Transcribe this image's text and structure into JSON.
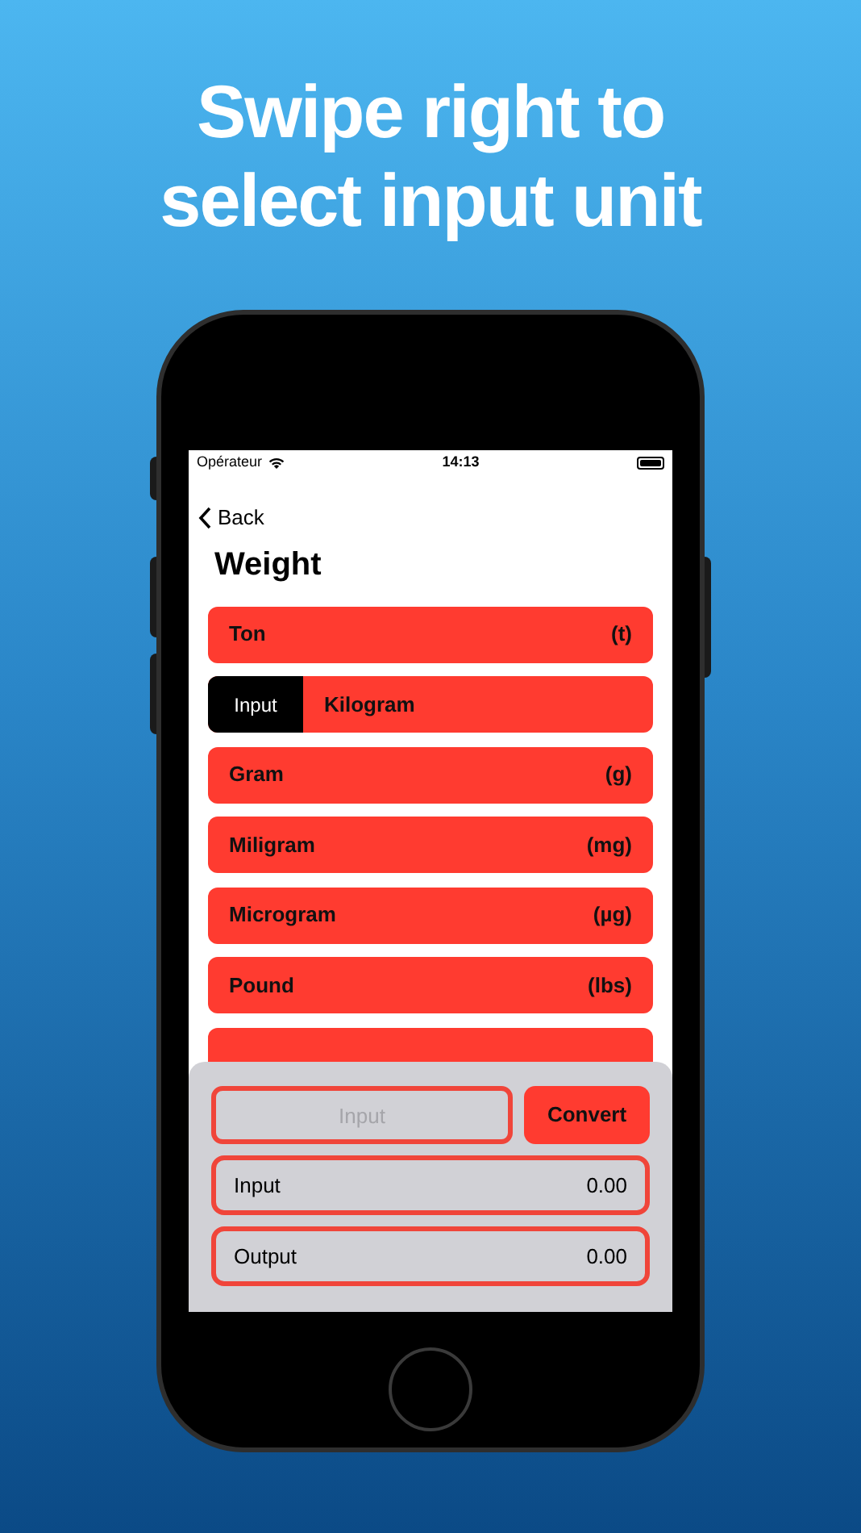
{
  "headline": [
    "Swipe right to",
    "select input unit"
  ],
  "status_bar": {
    "carrier": "Opérateur",
    "time": "14:13"
  },
  "nav": {
    "back": "Back",
    "title": "Weight"
  },
  "units": [
    {
      "name": "Ton",
      "unit": "(t)",
      "selected": false
    },
    {
      "tag": "Input",
      "name": "Kilogram",
      "selected": true
    },
    {
      "name": "Gram",
      "unit": "(g)",
      "selected": false
    },
    {
      "name": "Miligram",
      "unit": "(mg)",
      "selected": false
    },
    {
      "name": "Microgram",
      "unit": "(µg)",
      "selected": false
    },
    {
      "name": "Pound",
      "unit": "(lbs)",
      "selected": false
    }
  ],
  "panel": {
    "input_field": {
      "placeholder": "Input"
    },
    "convert_button": "Convert",
    "readouts": [
      {
        "label": "Input",
        "value": "0.00"
      },
      {
        "label": "Output",
        "value": "0.00"
      }
    ]
  }
}
